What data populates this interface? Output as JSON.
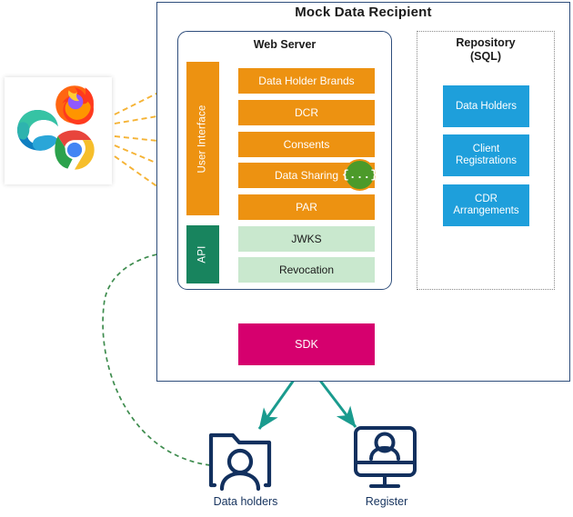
{
  "diagram": {
    "title": "Mock Data Recipient",
    "outer_border_color": "#2e4d7b"
  },
  "web_server": {
    "title": "Web Server",
    "ui_bar": {
      "label": "User Interface",
      "color": "#ED9211"
    },
    "api_bar": {
      "label": "API",
      "color": "#18845E"
    },
    "rows": [
      {
        "label": "Data Holder Brands",
        "style": "orange",
        "arrow_from": "user-interface"
      },
      {
        "label": "DCR",
        "style": "orange",
        "arrow_from": "user-interface"
      },
      {
        "label": "Consents",
        "style": "orange",
        "arrow_from": "user-interface"
      },
      {
        "label": "Data Sharing",
        "style": "orange",
        "arrow_from": "user-interface",
        "badge": "{...}"
      },
      {
        "label": "PAR",
        "style": "orange",
        "arrow_from": "user-interface"
      },
      {
        "label": "JWKS",
        "style": "green",
        "arrow_from": "api"
      },
      {
        "label": "Revocation",
        "style": "green",
        "arrow_from": "api"
      }
    ],
    "badge_color": "#4C9A2A"
  },
  "repository": {
    "title_line1": "Repository",
    "title_line2": "(SQL)",
    "items": [
      {
        "label": "Data Holders"
      },
      {
        "label": "Client Registrations"
      },
      {
        "label": "CDR Arrangements"
      }
    ],
    "item_color": "#1E9FDB"
  },
  "sdk": {
    "label": "SDK",
    "color": "#D6006E"
  },
  "browsers": {
    "icons": [
      {
        "name": "edge-browser-icon",
        "label": "Microsoft Edge"
      },
      {
        "name": "firefox-browser-icon",
        "label": "Mozilla Firefox"
      },
      {
        "name": "chrome-browser-icon",
        "label": "Google Chrome"
      }
    ]
  },
  "external_nodes": [
    {
      "name": "data-holders",
      "label": "Data holders",
      "icon": "folder-user-icon"
    },
    {
      "name": "register",
      "label": "Register",
      "icon": "monitor-user-icon"
    }
  ],
  "connectors": {
    "browser_to_ui": {
      "style": "dashed",
      "color": "#F5B335",
      "count": 5
    },
    "web_server_to_repository": {
      "style": "double-arrow",
      "color": "#1A9B8E"
    },
    "web_server_to_sdk": {
      "style": "double-arrow",
      "color": "#1A9B8E"
    },
    "sdk_to_data_holders": {
      "style": "double-arrow",
      "color": "#1A9B8E"
    },
    "sdk_to_register": {
      "style": "double-arrow",
      "color": "#1A9B8E"
    },
    "data_holders_to_api": {
      "style": "dashed-curve",
      "color": "#3E8C4E"
    }
  }
}
